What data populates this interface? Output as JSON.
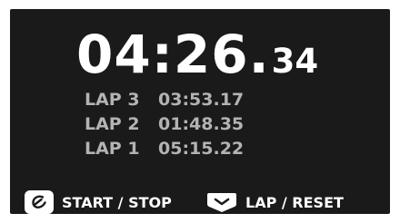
{
  "timer": {
    "main": "04:26.",
    "centiseconds": "34"
  },
  "laps": [
    {
      "name": "LAP 3",
      "time": "03:53.17"
    },
    {
      "name": "LAP 2",
      "time": "01:48.35"
    },
    {
      "name": "LAP 1",
      "time": "05:15.22"
    }
  ],
  "controls": {
    "start_stop": {
      "label": "START / STOP",
      "icon": "start-stop-icon"
    },
    "lap_reset": {
      "label": "LAP / RESET",
      "icon": "lap-reset-icon"
    }
  }
}
